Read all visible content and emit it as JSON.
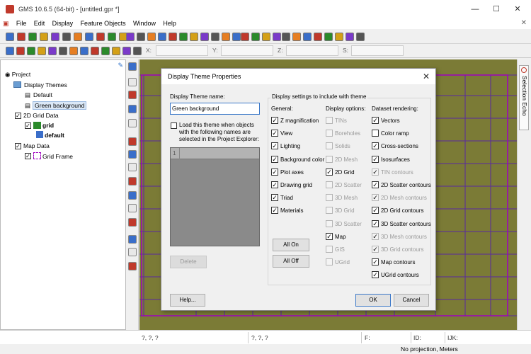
{
  "window": {
    "title": "GMS 10.6.5 (64-bit) - [untitled.gpr *]"
  },
  "menu": [
    "File",
    "Edit",
    "Display",
    "Feature Objects",
    "Window",
    "Help"
  ],
  "coords": {
    "x_label": "X:",
    "y_label": "Y:",
    "z_label": "Z:",
    "s_label": "S:"
  },
  "project_tree": {
    "root": "Project",
    "display_themes": "Display Themes",
    "default_theme": "Default",
    "green_theme": "Green background",
    "grid_data": "2D Grid Data",
    "grid": "grid",
    "grid_default": "default",
    "map_data": "Map Data",
    "grid_frame": "Grid Frame"
  },
  "side_panel": {
    "selection_echo": "Selection Echo"
  },
  "status": {
    "xy": "?, ?, ?",
    "xyz": "?, ?, ?",
    "f_label": "F:",
    "id_label": "ID:",
    "ijk_label": "IJK:",
    "projection": "No projection, Meters"
  },
  "dialog": {
    "title": "Display Theme Properties",
    "name_label": "Display Theme name:",
    "name_value": "Green background",
    "load_text": "Load this theme when objects with the following names are selected in the Project Explorer:",
    "list_first_row": "1",
    "delete_label": "Delete",
    "settings_label": "Display settings to include with theme",
    "general_header": "General:",
    "display_header": "Display options:",
    "dataset_header": "Dataset rendering:",
    "general": [
      {
        "label": "Z magnification",
        "checked": true,
        "enabled": true
      },
      {
        "label": "View",
        "checked": true,
        "enabled": true
      },
      {
        "label": "Lighting",
        "checked": true,
        "enabled": true
      },
      {
        "label": "Background color",
        "checked": true,
        "enabled": true
      },
      {
        "label": "Plot axes",
        "checked": true,
        "enabled": true
      },
      {
        "label": "Drawing grid",
        "checked": true,
        "enabled": true
      },
      {
        "label": "Triad",
        "checked": true,
        "enabled": true
      },
      {
        "label": "Materials",
        "checked": true,
        "enabled": true
      }
    ],
    "display_options": [
      {
        "label": "TINs",
        "checked": false,
        "enabled": false
      },
      {
        "label": "Boreholes",
        "checked": false,
        "enabled": false
      },
      {
        "label": "Solids",
        "checked": false,
        "enabled": false
      },
      {
        "label": "2D Mesh",
        "checked": false,
        "enabled": false
      },
      {
        "label": "2D Grid",
        "checked": true,
        "enabled": true
      },
      {
        "label": "2D Scatter",
        "checked": false,
        "enabled": false
      },
      {
        "label": "3D Mesh",
        "checked": false,
        "enabled": false
      },
      {
        "label": "3D Grid",
        "checked": false,
        "enabled": false
      },
      {
        "label": "3D Scatter",
        "checked": false,
        "enabled": false
      },
      {
        "label": "Map",
        "checked": true,
        "enabled": true
      },
      {
        "label": "GIS",
        "checked": false,
        "enabled": false
      },
      {
        "label": "UGrid",
        "checked": false,
        "enabled": false
      }
    ],
    "dataset_rendering": [
      {
        "label": "Vectors",
        "checked": true,
        "enabled": true
      },
      {
        "label": "Color ramp",
        "checked": false,
        "enabled": true
      },
      {
        "label": "Cross-sections",
        "checked": true,
        "enabled": true
      },
      {
        "label": "Isosurfaces",
        "checked": true,
        "enabled": true
      },
      {
        "label": "TIN contours",
        "checked": true,
        "enabled": false
      },
      {
        "label": "2D Scatter contours",
        "checked": true,
        "enabled": true
      },
      {
        "label": "2D Mesh contours",
        "checked": true,
        "enabled": false
      },
      {
        "label": "2D Grid contours",
        "checked": true,
        "enabled": true
      },
      {
        "label": "3D Scatter contours",
        "checked": true,
        "enabled": true
      },
      {
        "label": "3D Mesh contours",
        "checked": true,
        "enabled": false
      },
      {
        "label": "3D Grid contours",
        "checked": true,
        "enabled": false
      },
      {
        "label": "Map contours",
        "checked": true,
        "enabled": true
      },
      {
        "label": "UGrid contours",
        "checked": true,
        "enabled": true
      }
    ],
    "all_on": "All On",
    "all_off": "All Off",
    "help": "Help...",
    "ok": "OK",
    "cancel": "Cancel"
  },
  "colors": {
    "graphics_background": "#7b7b36",
    "grid_lines": "#5a2aa0",
    "grid_frame": "#a000c0"
  }
}
